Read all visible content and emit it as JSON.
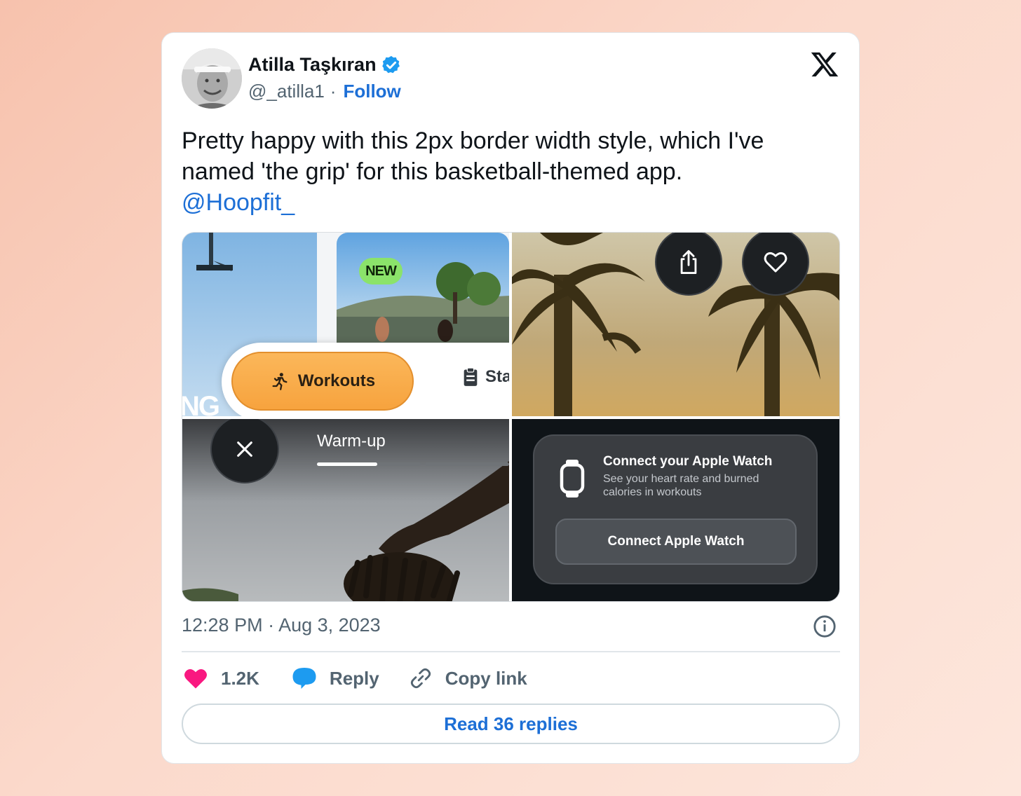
{
  "author": {
    "name": "Atilla Taşkıran",
    "handle": "@_atilla1",
    "separator": "·",
    "follow_label": "Follow"
  },
  "tweet": {
    "text": "Pretty happy with this 2px border width style, which I've named 'the grip' for this basketball-themed app.",
    "mention": "@Hoopfit_"
  },
  "media": {
    "tile1": {
      "badge": "NEW",
      "workouts_label": "Workouts",
      "stats_label": "Sta",
      "partial_text": "NG"
    },
    "tile3": {
      "label": "Warm-up",
      "progress": 0.58
    },
    "tile4": {
      "title": "Connect your Apple Watch",
      "subtitle": "See your heart rate and burned calories in workouts",
      "button_label": "Connect Apple Watch"
    }
  },
  "meta": {
    "timestamp": "12:28 PM · Aug 3, 2023"
  },
  "actions": {
    "likes": "1.2K",
    "reply": "Reply",
    "copy_link": "Copy link",
    "read_replies": "Read 36 replies"
  },
  "colors": {
    "link": "#1d6fd6",
    "like": "#f91880",
    "reply_bubble": "#1d9bf0",
    "workouts": "#f7a33e",
    "badge": "#8be36a"
  },
  "icons": [
    "verified-badge-icon",
    "x-logo-icon",
    "share-icon",
    "heart-icon",
    "close-icon",
    "runner-icon",
    "clipboard-icon",
    "watch-icon",
    "info-icon",
    "like-heart-icon",
    "reply-bubble-icon",
    "link-icon"
  ]
}
